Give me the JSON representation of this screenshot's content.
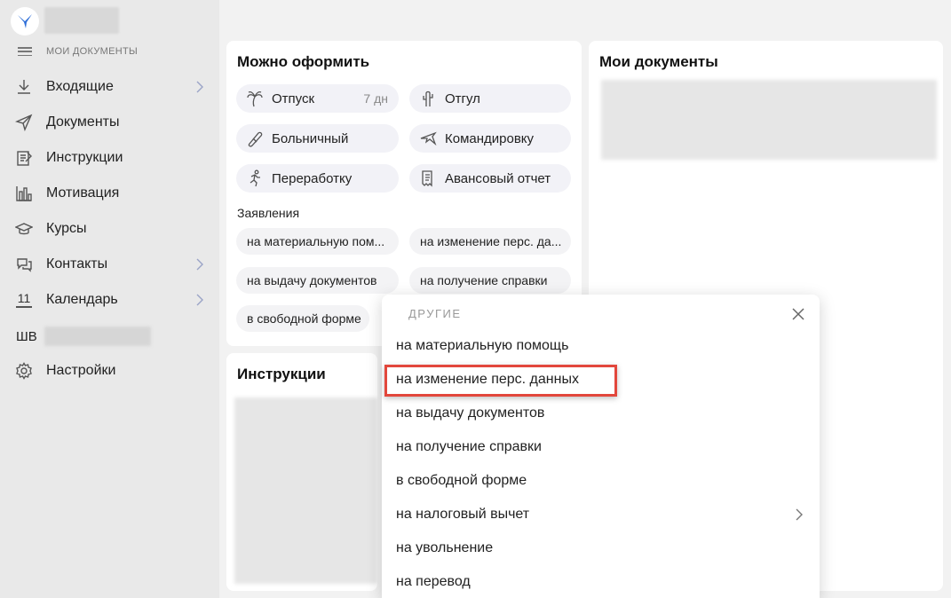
{
  "sidebar": {
    "section_label": "МОИ ДОКУМЕНТЫ",
    "items": [
      {
        "label": "Входящие",
        "icon": "download-icon",
        "has_chevron": true
      },
      {
        "label": "Документы",
        "icon": "send-icon",
        "has_chevron": false
      },
      {
        "label": "Инструкции",
        "icon": "checklist-icon",
        "has_chevron": false
      },
      {
        "label": "Мотивация",
        "icon": "bar-chart-icon",
        "has_chevron": false
      },
      {
        "label": "Курсы",
        "icon": "graduation-cap-icon",
        "has_chevron": false
      },
      {
        "label": "Контакты",
        "icon": "chat-bubbles-icon",
        "has_chevron": true
      },
      {
        "label": "Календарь",
        "icon": "calendar-icon",
        "calendar_day": "11",
        "has_chevron": true
      }
    ],
    "user_initials": "ШВ",
    "settings_label": "Настройки"
  },
  "can_apply": {
    "title": "Можно оформить",
    "chips": [
      {
        "label": "Отпуск",
        "extra": "7 дн",
        "icon": "palm-tree-icon"
      },
      {
        "label": "Отгул",
        "icon": "cactus-icon"
      },
      {
        "label": "Больничный",
        "icon": "pill-icon"
      },
      {
        "label": "Командировку",
        "icon": "airplane-icon"
      },
      {
        "label": "Переработку",
        "icon": "running-person-icon"
      },
      {
        "label": "Авансовый отчет",
        "icon": "receipt-icon"
      }
    ],
    "applications_label": "Заявления",
    "applications": [
      "на материальную пом...",
      "на изменение перс. да...",
      "на выдачу документов",
      "на получение справки",
      "в свободной форме"
    ]
  },
  "my_documents": {
    "title": "Мои документы"
  },
  "instructions": {
    "title": "Инструкции"
  },
  "dropdown": {
    "header": "ДРУГИЕ",
    "items": [
      "на материальную помощь",
      "на изменение перс. данных",
      "на выдачу документов",
      "на получение справки",
      "в свободной форме",
      "на налоговый вычет",
      "на увольнение",
      "на перевод"
    ],
    "highlighted_index": 1,
    "submenu_index": 5
  },
  "colors": {
    "highlight": "#e2473c",
    "logo_blue": "#2f6fd8",
    "icon_gray": "#555555"
  }
}
